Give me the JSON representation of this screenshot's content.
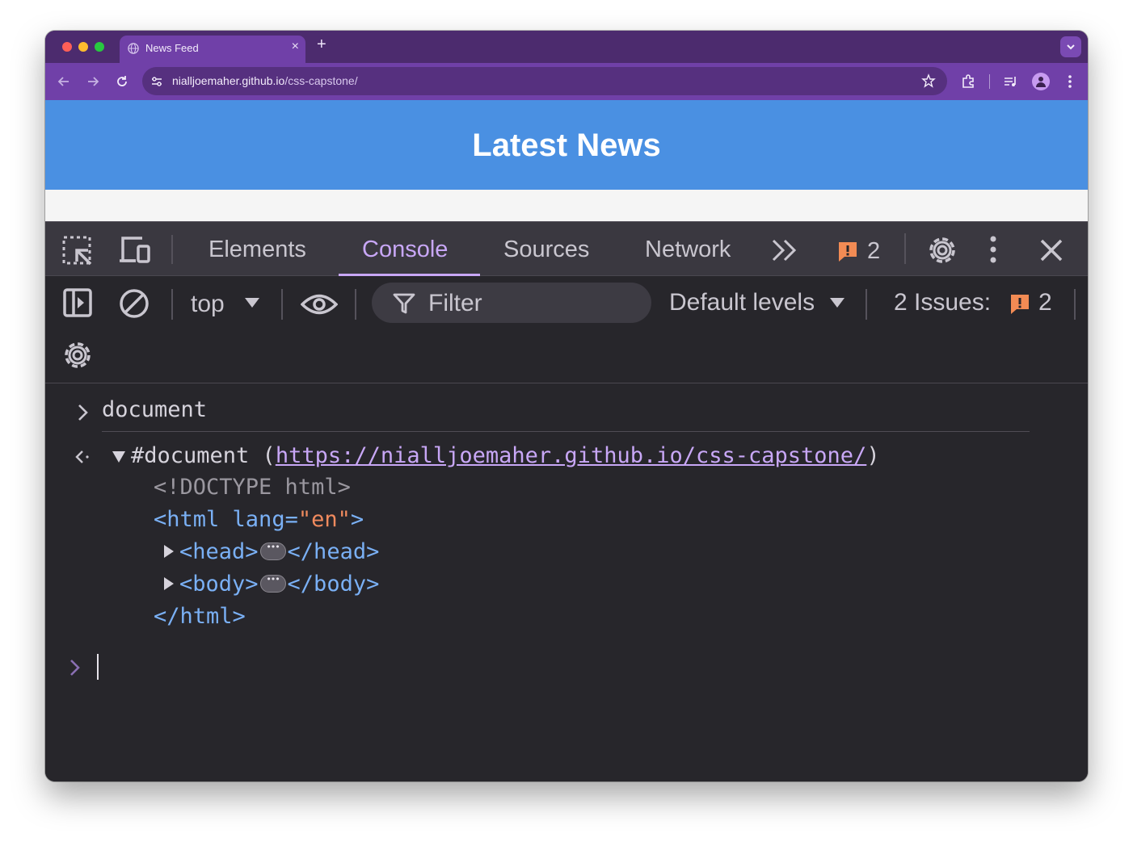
{
  "browser": {
    "traffic_lights": {
      "close": "#ff5f57",
      "minimize": "#febc2e",
      "zoom": "#28c840"
    },
    "tab": {
      "title": "News Feed",
      "icon": "globe-icon"
    },
    "new_tab_symbol": "+",
    "tab_close_symbol": "×",
    "url": {
      "host": "nialljoemaher.github.io",
      "path": "/css-capstone/"
    }
  },
  "page": {
    "heading": "Latest News",
    "header_color": "#4a90e2"
  },
  "devtools": {
    "tabs": [
      {
        "label": "Elements",
        "active": false
      },
      {
        "label": "Console",
        "active": true
      },
      {
        "label": "Sources",
        "active": false
      },
      {
        "label": "Network",
        "active": false
      }
    ],
    "more_tabs_symbol": "»",
    "issue_badge_count": "2",
    "console_toolbar": {
      "context": "top",
      "filter_placeholder": "Filter",
      "levels": "Default levels",
      "issues_label": "2 Issues:",
      "issues_count": "2"
    },
    "console": {
      "input_prompt": ">",
      "input_command": "document",
      "result_prefix": "#document (",
      "result_url": "https://nialljoemaher.github.io/css-capstone/",
      "result_suffix": ")",
      "doctype": "<!DOCTYPE html>",
      "html_open_tag": "<html",
      "html_attr_name": "lang=",
      "html_attr_value": "\"en\"",
      "html_open_close": ">",
      "head_open": "<head>",
      "head_close": "</head>",
      "body_open": "<body>",
      "body_close": "</body>",
      "html_close": "</html>"
    },
    "accent_color": "#c8a7f6",
    "warning_color": "#f28b54"
  }
}
